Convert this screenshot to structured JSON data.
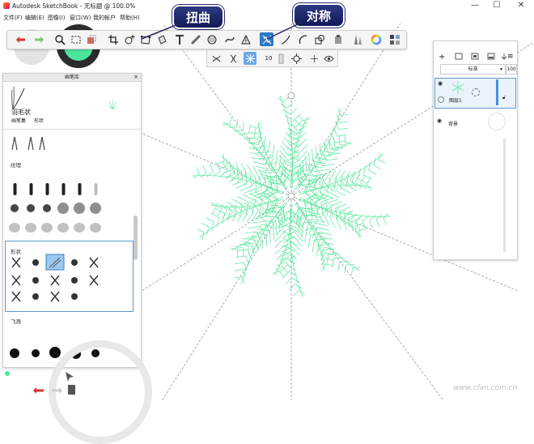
{
  "titlebar": {
    "title": "Autodesk SketchBook - 无标题 @ 100.0%",
    "minimize": "—",
    "maximize": "☐",
    "close": "✕"
  },
  "menu": {
    "items": [
      "文件(F)",
      "编辑(E)",
      "图像(I)",
      "窗口(W)",
      "我的帐户",
      "帮助(H)"
    ]
  },
  "callouts": {
    "distort": "扭曲",
    "symmetry": "对称"
  },
  "toolbar": {
    "tools": [
      "undo",
      "redo",
      "zoom",
      "select",
      "transform",
      "crop",
      "add",
      "distort",
      "fill",
      "text",
      "ruler",
      "ellipse",
      "curve",
      "perspective",
      "symmetry",
      "stroke",
      "french-curve",
      "shape",
      "copy",
      "brush-set",
      "color-wheel",
      "swatches"
    ]
  },
  "subbar": {
    "size_value": "10"
  },
  "brush_library": {
    "title": "画笔库",
    "preview": {
      "name": "羽毛状",
      "set": "画笔集",
      "kind": "形状"
    },
    "sections": {
      "texture": "纹理",
      "shape": "形状",
      "splatter": "飞溅"
    }
  },
  "layers": {
    "blend_mode": "标准",
    "opacity": "100",
    "layer1_name": "图层1",
    "background_name": "背景"
  },
  "watermark": "www.cfan.com.cn",
  "colors": {
    "accent": "#2f78c9",
    "stroke_green": "#5ee8a0",
    "callout": "#1c2668"
  }
}
